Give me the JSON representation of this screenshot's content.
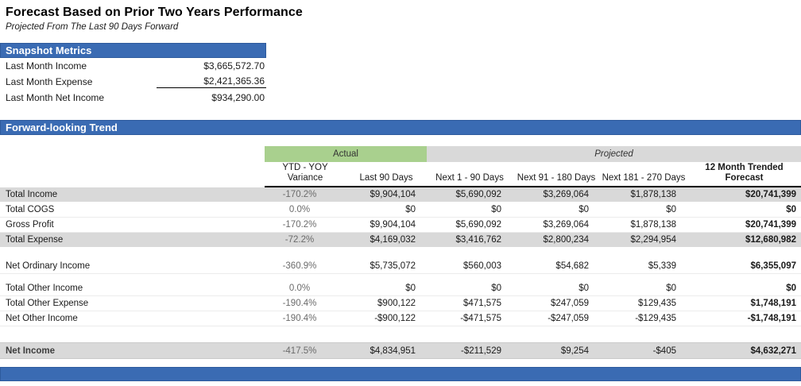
{
  "page": {
    "title": "Forecast Based on Prior Two Years Performance",
    "subtitle": "Projected From The Last 90 Days Forward"
  },
  "colors": {
    "section_bar_blue": "#3a6bb3",
    "actual_band_green": "#a9d08e",
    "projected_band_gray": "#d9d9d9",
    "shaded_row_gray": "#d9d9d9"
  },
  "snapshot": {
    "section_title": "Snapshot Metrics",
    "rows": [
      {
        "label": "Last Month Income",
        "value": "$3,665,572.70"
      },
      {
        "label": "Last Month Expense",
        "value": "$2,421,365.36"
      },
      {
        "label": "Last Month Net Income",
        "value": "$934,290.00"
      }
    ]
  },
  "trend": {
    "section_title": "Forward-looking Trend",
    "group_headers": {
      "actual": "Actual",
      "projected": "Projected"
    },
    "columns": [
      [
        "YTD - YOY",
        "Variance"
      ],
      [
        "Last 90 Days"
      ],
      [
        "Next 1 - 90 Days"
      ],
      [
        "Next 91 - 180 Days"
      ],
      [
        "Next 181 - 270 Days"
      ],
      [
        "12 Month Trended",
        "Forecast"
      ]
    ],
    "rows": [
      {
        "label": "Total Income",
        "cells": [
          "-170.2%",
          "$9,904,104",
          "$5,690,092",
          "$3,269,064",
          "$1,878,138",
          "$20,741,399"
        ],
        "shaded": true
      },
      {
        "label": "Total COGS",
        "cells": [
          "0.0%",
          "$0",
          "$0",
          "$0",
          "$0",
          "$0"
        ]
      },
      {
        "label": "Gross Profit",
        "cells": [
          "-170.2%",
          "$9,904,104",
          "$5,690,092",
          "$3,269,064",
          "$1,878,138",
          "$20,741,399"
        ]
      },
      {
        "label": "Total Expense",
        "cells": [
          "-72.2%",
          "$4,169,032",
          "$3,416,762",
          "$2,800,234",
          "$2,294,954",
          "$12,680,982"
        ],
        "shaded": true
      },
      {
        "label": "Net Ordinary Income",
        "cells": [
          "-360.9%",
          "$5,735,072",
          "$560,003",
          "$54,682",
          "$5,339",
          "$6,355,097"
        ],
        "gap_before": "md"
      },
      {
        "label": "Total Other Income",
        "cells": [
          "0.0%",
          "$0",
          "$0",
          "$0",
          "$0",
          "$0"
        ],
        "gap_before": "sm"
      },
      {
        "label": "Total Other Expense",
        "cells": [
          "-190.4%",
          "$900,122",
          "$471,575",
          "$247,059",
          "$129,435",
          "$1,748,191"
        ]
      },
      {
        "label": "Net Other Income",
        "cells": [
          "-190.4%",
          "-$900,122",
          "-$471,575",
          "-$247,059",
          "-$129,435",
          "-$1,748,191"
        ]
      },
      {
        "label": "Net Income",
        "cells": [
          "-417.5%",
          "$4,834,951",
          "-$211,529",
          "$9,254",
          "-$405",
          "$4,632,271"
        ],
        "shaded": true,
        "emphasis": true,
        "gap_before": "lg"
      }
    ]
  }
}
